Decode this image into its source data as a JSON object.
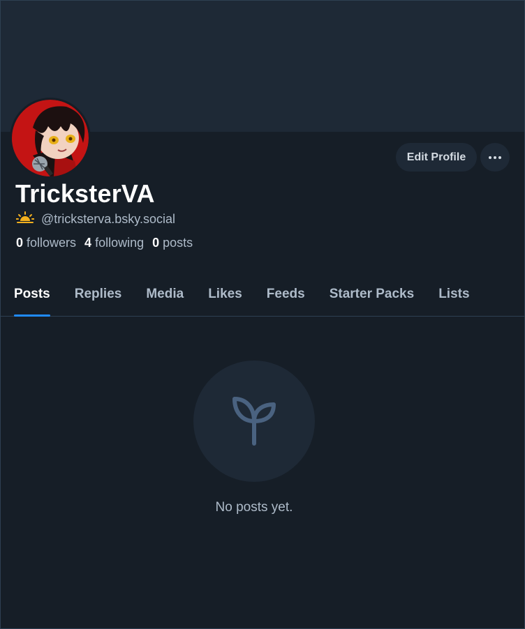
{
  "profile": {
    "display_name": "TricksterVA",
    "handle": "@tricksterva.bsky.social",
    "followers_count": "0",
    "followers_label": "followers",
    "following_count": "4",
    "following_label": "following",
    "posts_count": "0",
    "posts_label": "posts",
    "handle_icon": "sunrise-icon"
  },
  "actions": {
    "edit_profile_label": "Edit Profile",
    "more_icon": "more-horizontal-icon"
  },
  "tabs": [
    {
      "label": "Posts",
      "active": true
    },
    {
      "label": "Replies"
    },
    {
      "label": "Media"
    },
    {
      "label": "Likes"
    },
    {
      "label": "Feeds"
    },
    {
      "label": "Starter Packs"
    },
    {
      "label": "Lists"
    }
  ],
  "empty_state": {
    "icon": "sprout-icon",
    "message": "No posts yet."
  },
  "colors": {
    "background": "#161e27",
    "banner": "#1e2936",
    "accent": "#208bfe",
    "text_primary": "#ffffff",
    "text_secondary": "#aebbc9"
  }
}
